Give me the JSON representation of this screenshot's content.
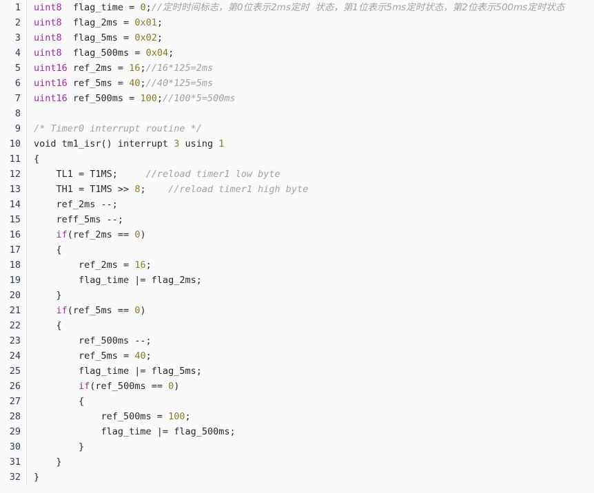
{
  "editor": {
    "name": "code-snippet-viewer",
    "language": "C",
    "background_color": "#fafafa",
    "gutter_separator_color": "#d8d8d8",
    "line_number_color": "#2f3a52",
    "colors": {
      "keyword": "#a626a4",
      "number": "#8a7a1f",
      "comment": "#9ea2a8",
      "plain": "#24292e"
    },
    "first_line_number": 1,
    "last_line_number": 32,
    "total_lines": 32
  },
  "lines": [
    {
      "num": "1",
      "tokens": [
        {
          "t": "kw",
          "v": "uint8"
        },
        {
          "t": "plain",
          "v": "  flag_time = "
        },
        {
          "t": "num",
          "v": "0"
        },
        {
          "t": "plain",
          "v": ";"
        },
        {
          "t": "comment",
          "v": "//"
        },
        {
          "t": "cjk",
          "v": "定时时间标志，第0位表示2ms定时  状态，第1位表示5ms定时状态，第2位表示500ms定时状态"
        }
      ]
    },
    {
      "num": "2",
      "tokens": [
        {
          "t": "kw",
          "v": "uint8"
        },
        {
          "t": "plain",
          "v": "  flag_2ms = "
        },
        {
          "t": "num",
          "v": "0x01"
        },
        {
          "t": "plain",
          "v": ";"
        }
      ]
    },
    {
      "num": "3",
      "tokens": [
        {
          "t": "kw",
          "v": "uint8"
        },
        {
          "t": "plain",
          "v": "  flag_5ms = "
        },
        {
          "t": "num",
          "v": "0x02"
        },
        {
          "t": "plain",
          "v": ";"
        }
      ]
    },
    {
      "num": "4",
      "tokens": [
        {
          "t": "kw",
          "v": "uint8"
        },
        {
          "t": "plain",
          "v": "  flag_500ms = "
        },
        {
          "t": "num",
          "v": "0x04"
        },
        {
          "t": "plain",
          "v": ";"
        }
      ]
    },
    {
      "num": "5",
      "tokens": [
        {
          "t": "kw",
          "v": "uint16"
        },
        {
          "t": "plain",
          "v": " ref_2ms = "
        },
        {
          "t": "num",
          "v": "16"
        },
        {
          "t": "plain",
          "v": ";"
        },
        {
          "t": "comment",
          "v": "//16*125=2ms"
        }
      ]
    },
    {
      "num": "6",
      "tokens": [
        {
          "t": "kw",
          "v": "uint16"
        },
        {
          "t": "plain",
          "v": " ref_5ms = "
        },
        {
          "t": "num",
          "v": "40"
        },
        {
          "t": "plain",
          "v": ";"
        },
        {
          "t": "comment",
          "v": "//40*125=5ms"
        }
      ]
    },
    {
      "num": "7",
      "tokens": [
        {
          "t": "kw",
          "v": "uint16"
        },
        {
          "t": "plain",
          "v": " ref_500ms = "
        },
        {
          "t": "num",
          "v": "100"
        },
        {
          "t": "plain",
          "v": ";"
        },
        {
          "t": "comment",
          "v": "//100*5=500ms"
        }
      ]
    },
    {
      "num": "8",
      "tokens": []
    },
    {
      "num": "9",
      "tokens": [
        {
          "t": "comment",
          "v": "/* Timer0 interrupt routine */"
        }
      ]
    },
    {
      "num": "10",
      "tokens": [
        {
          "t": "plain",
          "v": "void tm1_isr() interrupt "
        },
        {
          "t": "num",
          "v": "3"
        },
        {
          "t": "plain",
          "v": " using "
        },
        {
          "t": "num",
          "v": "1"
        }
      ]
    },
    {
      "num": "11",
      "tokens": [
        {
          "t": "plain",
          "v": "{"
        }
      ]
    },
    {
      "num": "12",
      "tokens": [
        {
          "t": "plain",
          "v": "    TL1 = T1MS;     "
        },
        {
          "t": "comment",
          "v": "//reload timer1 low byte"
        }
      ]
    },
    {
      "num": "13",
      "tokens": [
        {
          "t": "plain",
          "v": "    TH1 = T1MS >> "
        },
        {
          "t": "num",
          "v": "8"
        },
        {
          "t": "plain",
          "v": ";    "
        },
        {
          "t": "comment",
          "v": "//reload timer1 high byte"
        }
      ]
    },
    {
      "num": "14",
      "tokens": [
        {
          "t": "plain",
          "v": "    ref_2ms --;"
        }
      ]
    },
    {
      "num": "15",
      "tokens": [
        {
          "t": "plain",
          "v": "    reff_5ms --;"
        }
      ]
    },
    {
      "num": "16",
      "tokens": [
        {
          "t": "plain",
          "v": "    "
        },
        {
          "t": "kw",
          "v": "if"
        },
        {
          "t": "plain",
          "v": "(ref_2ms == "
        },
        {
          "t": "num",
          "v": "0"
        },
        {
          "t": "plain",
          "v": ")"
        }
      ]
    },
    {
      "num": "17",
      "tokens": [
        {
          "t": "plain",
          "v": "    {"
        }
      ]
    },
    {
      "num": "18",
      "tokens": [
        {
          "t": "plain",
          "v": "        ref_2ms = "
        },
        {
          "t": "num",
          "v": "16"
        },
        {
          "t": "plain",
          "v": ";"
        }
      ]
    },
    {
      "num": "19",
      "tokens": [
        {
          "t": "plain",
          "v": "        flag_time |= flag_2ms;"
        }
      ]
    },
    {
      "num": "20",
      "tokens": [
        {
          "t": "plain",
          "v": "    }"
        }
      ]
    },
    {
      "num": "21",
      "tokens": [
        {
          "t": "plain",
          "v": "    "
        },
        {
          "t": "kw",
          "v": "if"
        },
        {
          "t": "plain",
          "v": "(ref_5ms == "
        },
        {
          "t": "num",
          "v": "0"
        },
        {
          "t": "plain",
          "v": ")"
        }
      ]
    },
    {
      "num": "22",
      "tokens": [
        {
          "t": "plain",
          "v": "    {"
        }
      ]
    },
    {
      "num": "23",
      "tokens": [
        {
          "t": "plain",
          "v": "        ref_500ms --;"
        }
      ]
    },
    {
      "num": "24",
      "tokens": [
        {
          "t": "plain",
          "v": "        ref_5ms = "
        },
        {
          "t": "num",
          "v": "40"
        },
        {
          "t": "plain",
          "v": ";"
        }
      ]
    },
    {
      "num": "25",
      "tokens": [
        {
          "t": "plain",
          "v": "        flag_time |= flag_5ms;"
        }
      ]
    },
    {
      "num": "26",
      "tokens": [
        {
          "t": "plain",
          "v": "        "
        },
        {
          "t": "kw",
          "v": "if"
        },
        {
          "t": "plain",
          "v": "(ref_500ms == "
        },
        {
          "t": "num",
          "v": "0"
        },
        {
          "t": "plain",
          "v": ")"
        }
      ]
    },
    {
      "num": "27",
      "tokens": [
        {
          "t": "plain",
          "v": "        {"
        }
      ]
    },
    {
      "num": "28",
      "tokens": [
        {
          "t": "plain",
          "v": "            ref_500ms = "
        },
        {
          "t": "num",
          "v": "100"
        },
        {
          "t": "plain",
          "v": ";"
        }
      ]
    },
    {
      "num": "29",
      "tokens": [
        {
          "t": "plain",
          "v": "            flag_time |= flag_500ms;"
        }
      ]
    },
    {
      "num": "30",
      "tokens": [
        {
          "t": "plain",
          "v": "        }"
        }
      ]
    },
    {
      "num": "31",
      "tokens": [
        {
          "t": "plain",
          "v": "    }"
        }
      ]
    },
    {
      "num": "32",
      "tokens": [
        {
          "t": "plain",
          "v": "}"
        }
      ]
    }
  ]
}
